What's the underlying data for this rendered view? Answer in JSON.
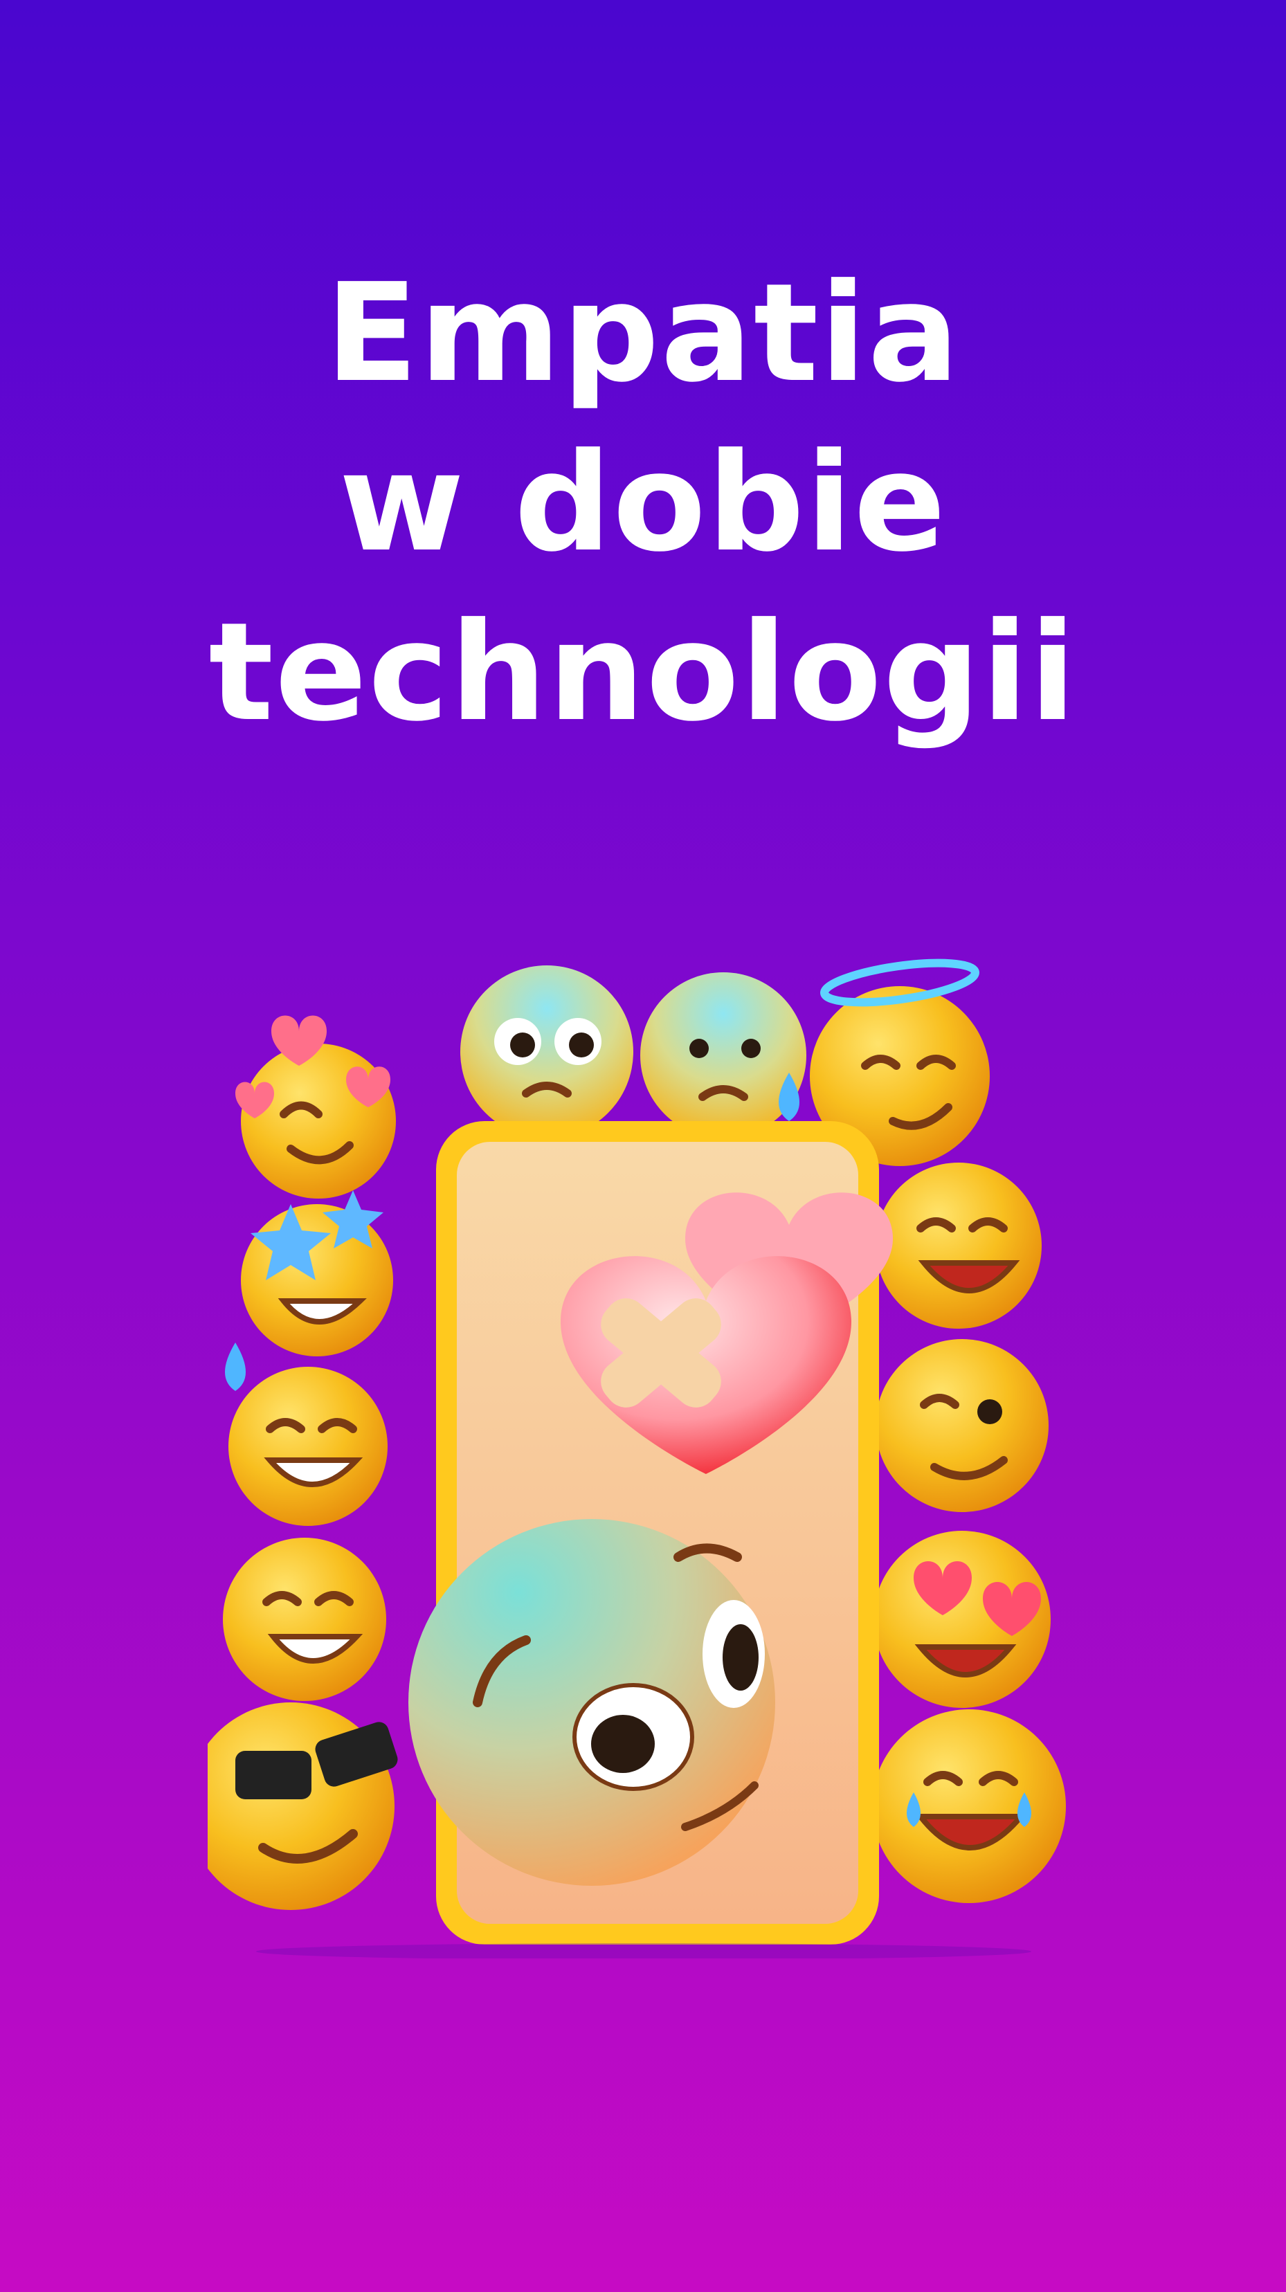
{
  "title": {
    "line1": "Empatia",
    "line2": "w dobie",
    "line3": "technologii"
  },
  "illustration": {
    "icon": "smartphone-emoji-icon"
  },
  "colors": {
    "background_top": "#4a06cf",
    "background_bottom": "#c60bc4",
    "emoji_yellow": "#f6b817",
    "phone_frame": "#ffc91e",
    "heart_pink": "#ff7d8e"
  }
}
